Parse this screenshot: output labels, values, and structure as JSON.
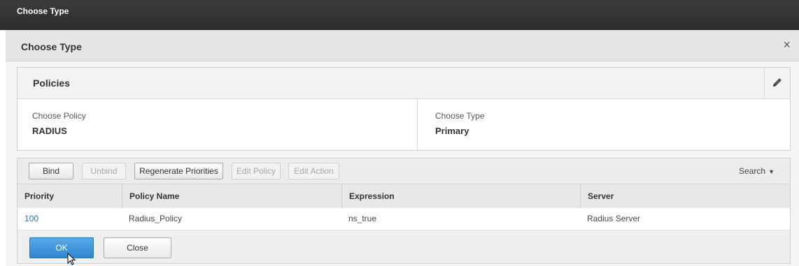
{
  "topbar": {
    "title": "Choose Type"
  },
  "dialog": {
    "title": "Choose Type",
    "close_glyph": "×"
  },
  "panel": {
    "title": "Policies",
    "edit_icon": "pencil-icon",
    "fields": [
      {
        "label": "Choose Policy",
        "value": "RADIUS"
      },
      {
        "label": "Choose Type",
        "value": "Primary"
      }
    ]
  },
  "toolbar": {
    "buttons": [
      {
        "label": "Bind",
        "enabled": true
      },
      {
        "label": "Unbind",
        "enabled": false
      },
      {
        "label": "Regenerate Priorities",
        "enabled": true
      },
      {
        "label": "Edit Policy",
        "enabled": false
      },
      {
        "label": "Edit Action",
        "enabled": false
      }
    ],
    "search_label": "Search",
    "search_caret": "▼"
  },
  "table": {
    "columns": [
      "Priority",
      "Policy Name",
      "Expression",
      "Server"
    ],
    "rows": [
      [
        "100",
        "Radius_Policy",
        "ns_true",
        "Radius Server"
      ]
    ]
  },
  "footer": {
    "ok_label": "OK",
    "close_label": "Close"
  },
  "colors": {
    "accent": "#2f86cf",
    "link": "#2a6fb7",
    "topbar": "#2c2c2c"
  }
}
